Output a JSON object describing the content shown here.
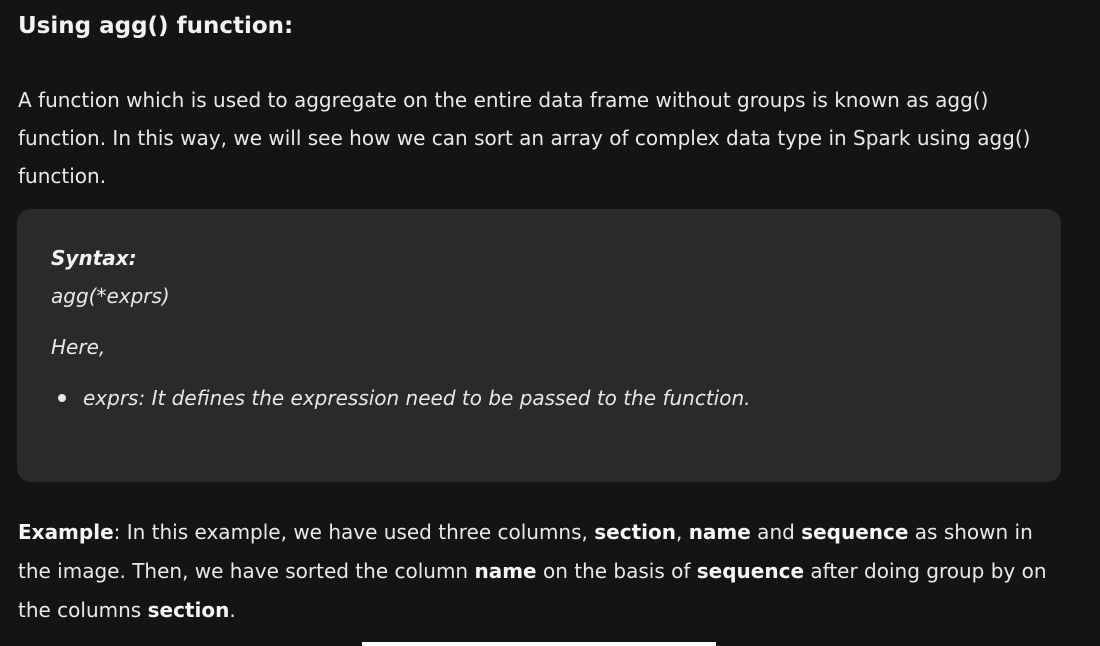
{
  "heading": "Using agg() function:",
  "intro": "A function which is used to aggregate on the entire data frame without groups is known as agg() function. In this way, we will see how we can sort an array of complex data type in Spark using agg() function.",
  "syntax_box": {
    "label": "Syntax:",
    "code": "agg(*exprs)",
    "here": "Here,",
    "params": [
      "exprs: It defines the expression need to be passed to the function."
    ]
  },
  "example": {
    "label": "Example",
    "text_1": ": In this example, we have used three columns, ",
    "col_section": "section",
    "sep_1": ", ",
    "col_name": "name",
    "text_2": " and ",
    "col_sequence": "sequence",
    "text_3": " as shown in the image. Then, we have sorted the column ",
    "col_name_2": "name",
    "text_4": " on the basis of ",
    "col_sequence_2": "sequence",
    "text_5": " after doing group by on the columns ",
    "col_section_2": "section",
    "text_6": "."
  }
}
